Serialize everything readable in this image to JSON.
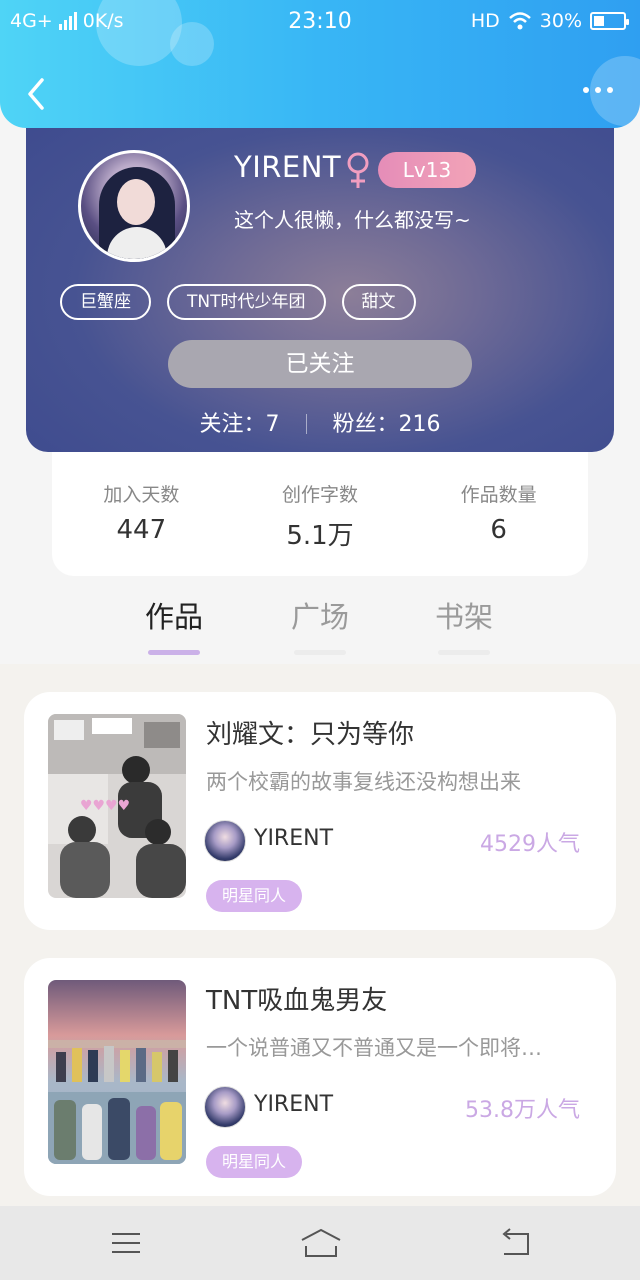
{
  "status_bar": {
    "network": "4G+",
    "speed": "0K/s",
    "time": "23:10",
    "hd": "HD",
    "battery": "30%"
  },
  "profile": {
    "username": "YIRENT",
    "level": "Lv13",
    "bio": "这个人很懒，什么都没写~",
    "tags": [
      "巨蟹座",
      "TNT时代少年团",
      "甜文"
    ],
    "follow_button": "已关注",
    "following_label": "关注：",
    "following_count": "7",
    "fans_label": "粉丝：",
    "fans_count": "216"
  },
  "stats": [
    {
      "label": "加入天数",
      "value": "447"
    },
    {
      "label": "创作字数",
      "value": "5.1万"
    },
    {
      "label": "作品数量",
      "value": "6"
    }
  ],
  "tabs": [
    "作品",
    "广场",
    "书架"
  ],
  "works": [
    {
      "title": "刘耀文：只为等你",
      "desc": "两个校霸的故事复线还没构想出来",
      "author": "YIRENT",
      "popularity": "4529人气",
      "category": "明星同人"
    },
    {
      "title": "TNT吸血鬼男友",
      "desc": "一个说普通又不普通又是一个即将…",
      "author": "YIRENT",
      "popularity": "53.8万人气",
      "category": "明星同人"
    }
  ],
  "colors": {
    "header_gradient_start": "#4fd4f6",
    "header_gradient_end": "#2f9ff1",
    "accent_purple": "#cbb1e8",
    "level_badge": "#e58db8"
  }
}
